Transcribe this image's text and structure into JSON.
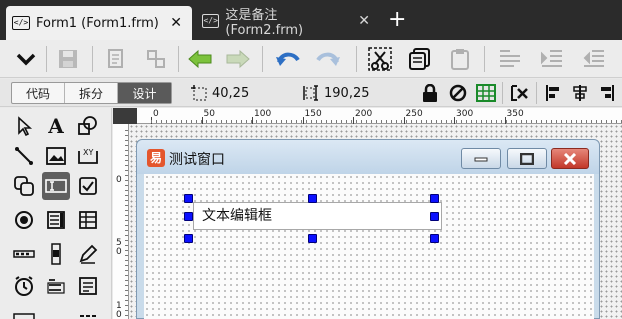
{
  "tabs": [
    {
      "label": "Form1 (Form1.frm)",
      "active": true,
      "icon": "code-file-icon"
    },
    {
      "label": "这是备注 (Form2.frm)",
      "active": false,
      "icon": "code-file-icon"
    }
  ],
  "tab_close_glyph": "✕",
  "add_tab_glyph": "+",
  "modes": [
    "代码",
    "拆分",
    "设计"
  ],
  "active_mode": "设计",
  "position": "40,25",
  "size": "190,25",
  "ruler": {
    "top": [
      "0",
      "50",
      "100",
      "150",
      "200",
      "250",
      "300",
      "350"
    ],
    "left": [
      "0",
      "5\n0",
      "1\n0"
    ]
  },
  "form": {
    "title": "测试窗口",
    "textbox_value": "文本编辑框"
  },
  "colors": {
    "accent_handle": "#0b10ff",
    "selected_tool": "#5f5f5f"
  }
}
